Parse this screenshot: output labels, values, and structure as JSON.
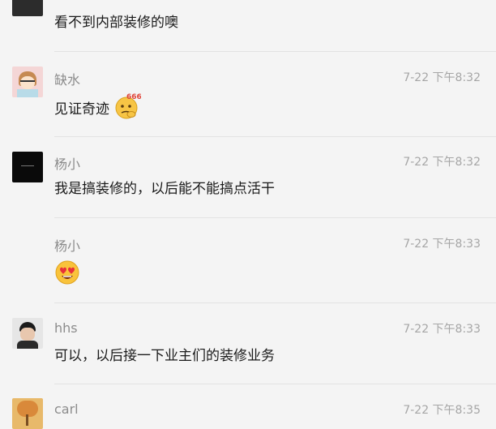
{
  "comments": [
    {
      "name": "",
      "time": "",
      "text": "看不到内部装修的噢"
    },
    {
      "name": "缺水",
      "time": "7-22 下午8:32",
      "text": "见证奇迹",
      "sticker": "666"
    },
    {
      "name": "杨小",
      "time": "7-22 下午8:32",
      "text": "我是搞装修的，以后能不能搞点活干"
    },
    {
      "name": "杨小",
      "time": "7-22 下午8:33",
      "text": ""
    },
    {
      "name": "hhs",
      "time": "7-22 下午8:33",
      "text": "可以，以后接一下业主们的装修业务"
    },
    {
      "name": "carl",
      "time": "7-22 下午8:35",
      "text": ""
    }
  ],
  "icons": {
    "avatar_1": "avatar-man-dark-icon",
    "avatar_2": "avatar-cartoon-girl-icon",
    "avatar_3": "avatar-black-logo-icon",
    "avatar_5": "avatar-boy-photo-icon",
    "avatar_6": "avatar-autumn-tree-icon",
    "emoji_666": "thinking-666-emoji-icon",
    "emoji_heart_eyes": "heart-eyes-emoji-icon"
  }
}
